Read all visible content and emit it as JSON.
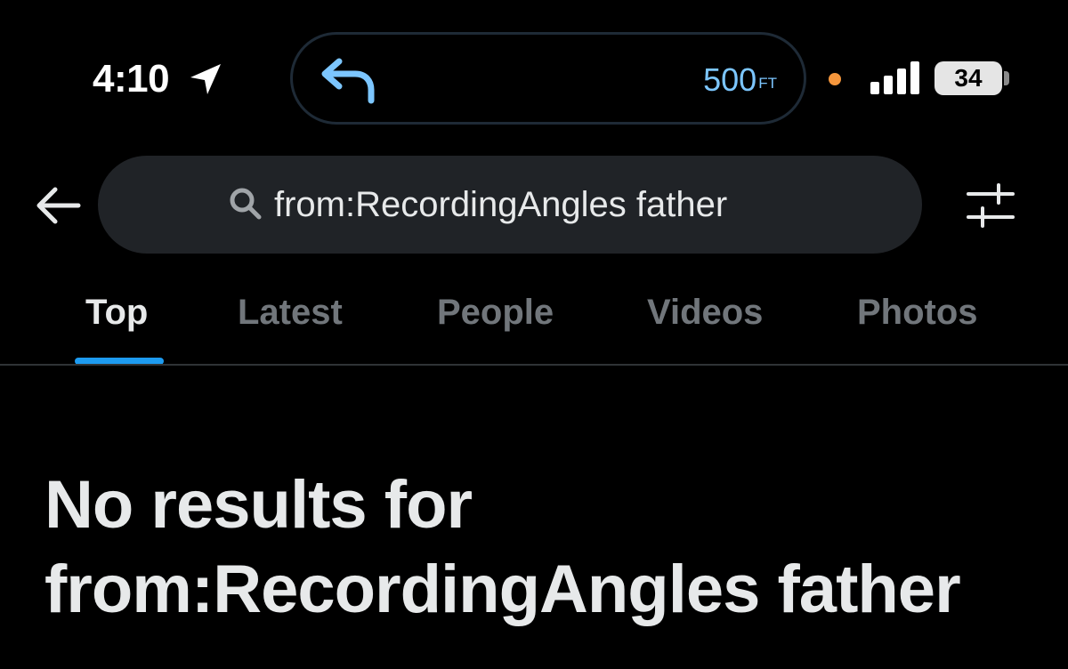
{
  "status_bar": {
    "time": "4:10",
    "navigation": {
      "distance": "500",
      "unit": "FT"
    },
    "battery": "34"
  },
  "search": {
    "query": "from:RecordingAngles father"
  },
  "tabs": [
    {
      "label": "Top",
      "active": true
    },
    {
      "label": "Latest",
      "active": false
    },
    {
      "label": "People",
      "active": false
    },
    {
      "label": "Videos",
      "active": false
    },
    {
      "label": "Photos",
      "active": false
    }
  ],
  "empty_state": {
    "title": "No results for from:RecordingAngles father"
  },
  "colors": {
    "accent": "#1d9bf0",
    "nav_text": "#7cc6ff",
    "recording_dot": "#f5963c",
    "background": "#000000"
  },
  "icons": [
    "location-arrow-icon",
    "turn-left-icon",
    "signal-icon",
    "back-arrow-icon",
    "search-icon",
    "filter-sliders-icon"
  ]
}
